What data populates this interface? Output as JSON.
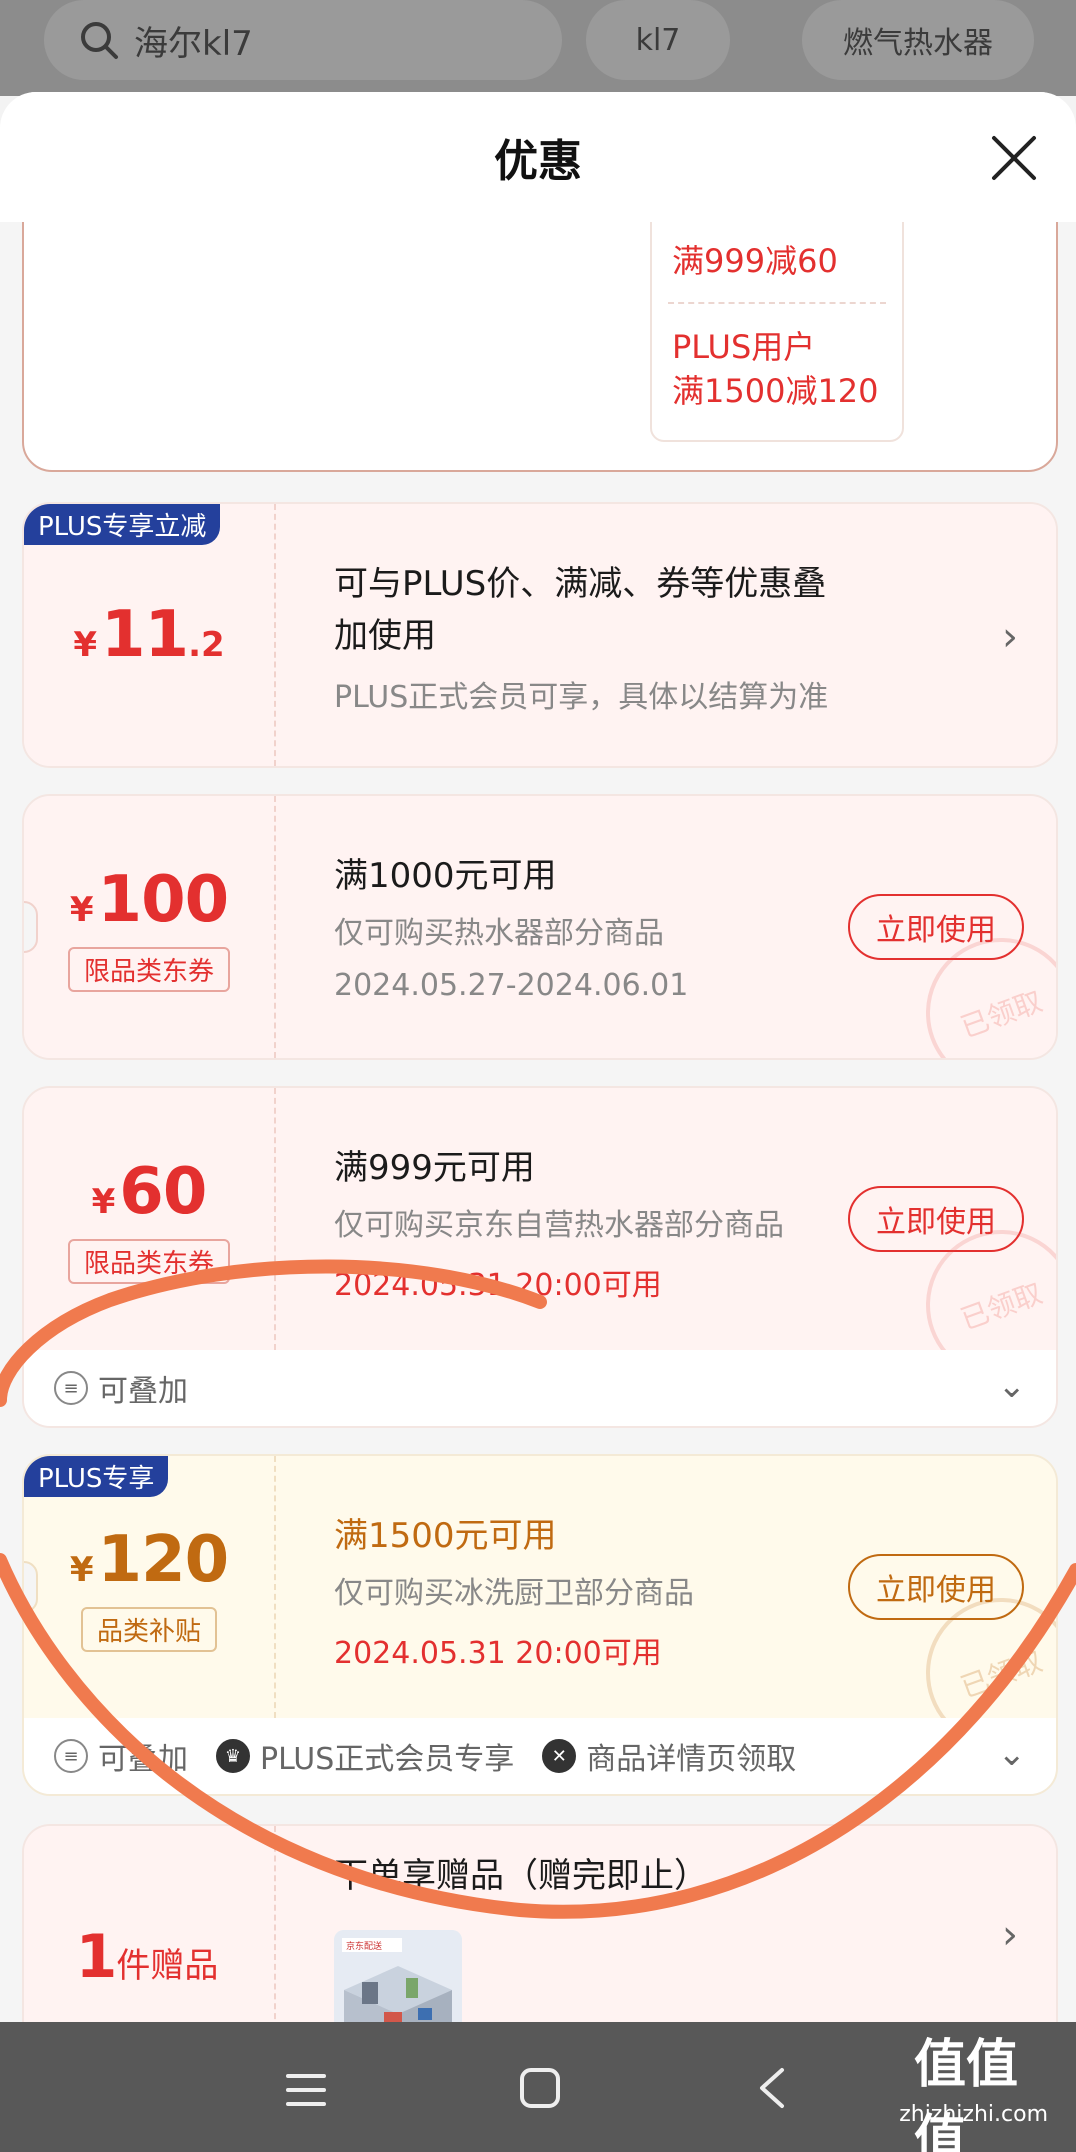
{
  "topbar": {
    "search_text": "海尔kl7",
    "chips": [
      "kl7",
      "燃气热水器"
    ]
  },
  "sheet": {
    "title": "优惠"
  },
  "partial_card": {
    "line1": "满999减60",
    "line2": "PLUS用户",
    "line3": "满1500减120"
  },
  "coupons": [
    {
      "ribbon": "PLUS专享立减",
      "yen": "¥",
      "amount": "11",
      "decimal": ".2",
      "title_line1": "可与PLUS价、满减、券等优惠叠",
      "title_line2": "加使用",
      "sub": "PLUS正式会员可享，具体以结算为准"
    },
    {
      "yen": "¥",
      "amount": "100",
      "tag": "限品类东券",
      "title": "满1000元可用",
      "sub": "仅可购买热水器部分商品",
      "date": "2024.05.27-2024.06.01",
      "button": "立即使用",
      "stamp": "已领取"
    },
    {
      "yen": "¥",
      "amount": "60",
      "tag": "限品类东券",
      "title": "满999元可用",
      "sub": "仅可购买京东自营热水器部分商品",
      "date": "2024.05.31 20:00可用",
      "button": "立即使用",
      "stamp": "已领取",
      "footer": [
        "可叠加"
      ]
    },
    {
      "ribbon": "PLUS专享",
      "yen": "¥",
      "amount": "120",
      "tag": "品类补贴",
      "title": "满1500元可用",
      "sub": "仅可购买冰洗厨卫部分商品",
      "date": "2024.05.31 20:00可用",
      "button": "立即使用",
      "stamp": "已领取",
      "footer": [
        "可叠加",
        "PLUS正式会员专享",
        "商品详情页领取"
      ]
    },
    {
      "amount": "1",
      "unit": "件赠品",
      "title": "下单享赠品（赠完即止）",
      "thumb_caption": "京东配送"
    }
  ],
  "watermark": {
    "big": "值值值",
    "small": "zhizhizhi.com"
  },
  "colors": {
    "accent_red": "#e3302f",
    "gold": "#c06a11",
    "plus_blue": "#24409c",
    "stroke_orange": "#f07a4e"
  }
}
